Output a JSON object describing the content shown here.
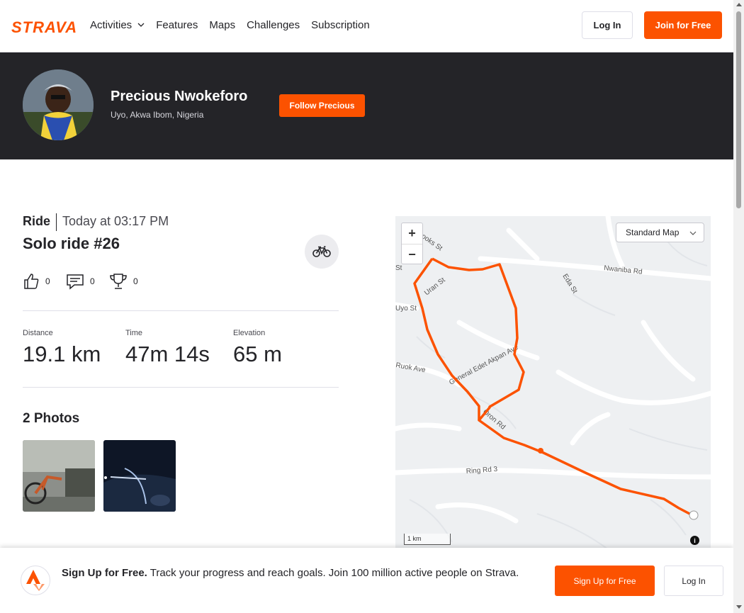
{
  "nav": {
    "logo": "STRAVA",
    "links": [
      "Activities",
      "Features",
      "Maps",
      "Challenges",
      "Subscription"
    ],
    "login": "Log In",
    "join": "Join for Free"
  },
  "athlete": {
    "name": "Precious Nwokeforo",
    "location": "Uyo, Akwa Ibom, Nigeria",
    "follow": "Follow Precious"
  },
  "activity": {
    "type": "Ride",
    "date": "Today at 03:17 PM",
    "title": "Solo ride #26",
    "kudos": "0",
    "comments": "0",
    "achievements": "0",
    "stats": [
      {
        "label": "Distance",
        "value": "19.1 km"
      },
      {
        "label": "Time",
        "value": "47m 14s"
      },
      {
        "label": "Elevation",
        "value": "65 m"
      }
    ],
    "photos_title": "2 Photos"
  },
  "map": {
    "zoom_in": "+",
    "zoom_out": "−",
    "map_type": "Standard Map",
    "scale": "1 km",
    "streets": [
      "Brooks St",
      "Nwaniba Rd",
      "Uran St",
      "Eda St",
      "St",
      "Uyo St",
      "Ruok Ave",
      "General Edet Akpan Ave",
      "Oron Rd",
      "Ring Rd 3"
    ],
    "route_color": "#fc5200"
  },
  "banner": {
    "bold": "Sign Up for Free.",
    "text": " Track your progress and reach goals. Join 100 million active people on Strava.",
    "signup": "Sign Up for Free",
    "login": "Log In"
  },
  "colors": {
    "brand": "#fc5200",
    "dark": "#242428"
  }
}
